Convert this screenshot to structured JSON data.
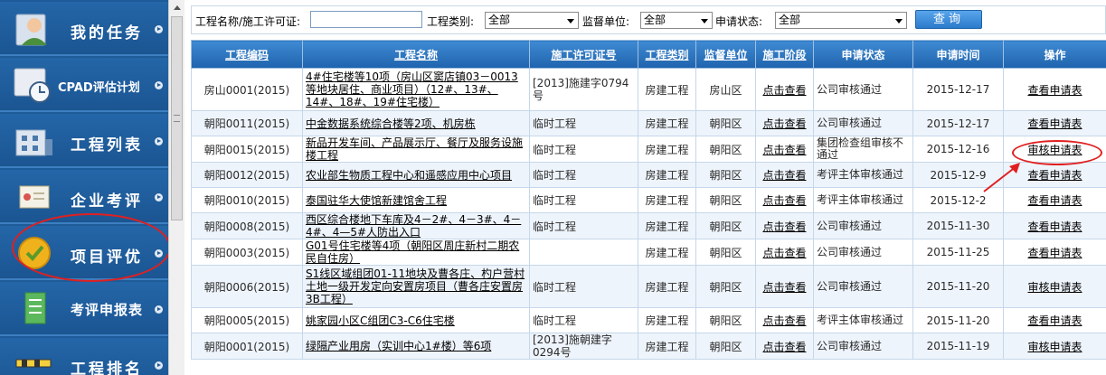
{
  "sidebar": {
    "items": [
      {
        "label": "我的任务",
        "icon": "user-icon"
      },
      {
        "label": "CPAD评估计划",
        "icon": "clock-folder-icon"
      },
      {
        "label": "工程列表",
        "icon": "building-icon"
      },
      {
        "label": "企业考评",
        "icon": "certificate-icon"
      },
      {
        "label": "项目评优",
        "icon": "medal-icon"
      },
      {
        "label": "考评申报表",
        "icon": "document-icon"
      },
      {
        "label": "工程排名",
        "icon": "barrier-icon"
      }
    ]
  },
  "filter": {
    "name_label": "工程名称/施工许可证:",
    "name_value": "",
    "type_label": "工程类别:",
    "type_value": "全部",
    "unit_label": "监督单位:",
    "unit_value": "全部",
    "status_label": "申请状态:",
    "status_value": "全部",
    "query_label": "查询"
  },
  "table": {
    "headers": [
      "工程编码",
      "工程名称",
      "施工许可证号",
      "工程类别",
      "监督单位",
      "施工阶段",
      "申请状态",
      "申请时间",
      "操作"
    ],
    "rows": [
      {
        "code": "房山0001(2015)",
        "name": "4#住宅楼等10项（房山区窦店镇03－0013等地块居住、商业项目）（12#、13#、14#、18#、19#住宅楼）",
        "permit": "[2013]施建字0794号",
        "category": "房建工程",
        "unit": "房山区",
        "stage": "点击查看",
        "status": "公司审核通过",
        "date": "2015-12-17",
        "action": "查看申请表"
      },
      {
        "code": "朝阳0011(2015)",
        "name": "中金数据系统综合楼等2项、机房栋",
        "permit": "临时工程",
        "category": "房建工程",
        "unit": "朝阳区",
        "stage": "点击查看",
        "status": "公司审核通过",
        "date": "2015-12-17",
        "action": "查看申请表"
      },
      {
        "code": "朝阳0015(2015)",
        "name": "新品开发车间、产品展示厅、餐厅及服务设施楼工程",
        "permit": "临时工程",
        "category": "房建工程",
        "unit": "朝阳区",
        "stage": "点击查看",
        "status": "集团检查组审核不通过",
        "date": "2015-12-16",
        "action": "审核申请表"
      },
      {
        "code": "朝阳0012(2015)",
        "name": "农业部生物质工程中心和遥感应用中心项目",
        "permit": "临时工程",
        "category": "房建工程",
        "unit": "朝阳区",
        "stage": "点击查看",
        "status": "考评主体审核通过",
        "date": "2015-12-9",
        "action": "查看申请表"
      },
      {
        "code": "朝阳0010(2015)",
        "name": "泰国驻华大使馆新建馆舍工程",
        "permit": "临时工程",
        "category": "房建工程",
        "unit": "朝阳区",
        "stage": "点击查看",
        "status": "考评主体审核通过",
        "date": "2015-12-2",
        "action": "查看申请表"
      },
      {
        "code": "朝阳0008(2015)",
        "name": "西区综合楼地下车库及4－2#、4－3#、4－4#、4—5#人防出入口",
        "permit": "临时工程",
        "category": "房建工程",
        "unit": "朝阳区",
        "stage": "点击查看",
        "status": "公司审核通过",
        "date": "2015-11-30",
        "action": "查看申请表"
      },
      {
        "code": "朝阳0003(2015)",
        "name": "G01号住宅楼等4项（朝阳区周庄新村二期农民自住房）",
        "permit": "",
        "category": "房建工程",
        "unit": "朝阳区",
        "stage": "点击查看",
        "status": "公司审核通过",
        "date": "2015-11-25",
        "action": "查看申请表"
      },
      {
        "code": "朝阳0006(2015)",
        "name": "S1线区域组团01-11地块及曹各庄、杓户营村土地一级开发定向安置房项目（曹各庄安置房3B工程）",
        "permit": "临时工程",
        "category": "房建工程",
        "unit": "朝阳区",
        "stage": "点击查看",
        "status": "公司审核通过",
        "date": "2015-11-20",
        "action": "审核申请表"
      },
      {
        "code": "朝阳0005(2015)",
        "name": "姚家园小区C组团C3-C6住宅楼",
        "permit": "临时工程",
        "category": "房建工程",
        "unit": "朝阳区",
        "stage": "点击查看",
        "status": "考评主体审核通过",
        "date": "2015-11-20",
        "action": "查看申请表"
      },
      {
        "code": "朝阳0001(2015)",
        "name": "绿隔产业用房（实训中心1#楼）等6项",
        "permit": "[2013]施朝建字0294号",
        "category": "房建工程",
        "unit": "朝阳区",
        "stage": "点击查看",
        "status": "公司审核通过",
        "date": "2015-11-19",
        "action": "审核申请表"
      }
    ]
  },
  "colors": {
    "sidebar": "#1d5b99",
    "header": "#2b74c0",
    "annotation": "#e02020",
    "temporary_text": "#e02020"
  }
}
